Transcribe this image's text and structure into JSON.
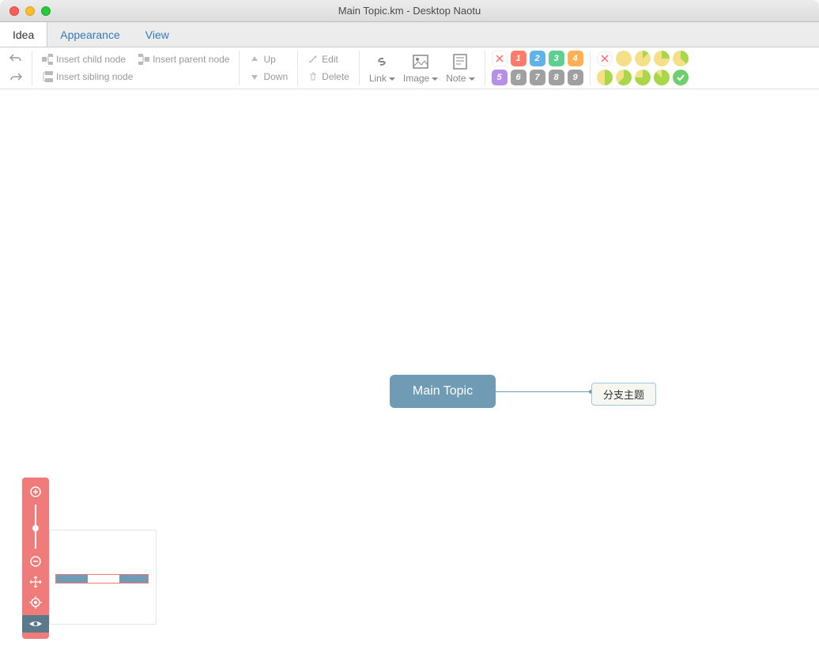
{
  "window": {
    "title": "Main Topic.km - Desktop Naotu"
  },
  "tabs": {
    "idea": "Idea",
    "appearance": "Appearance",
    "view": "View",
    "active": "idea"
  },
  "toolbar": {
    "undo": "Undo",
    "redo": "Redo",
    "insert_child": "Insert child node",
    "insert_parent": "Insert parent node",
    "insert_sibling": "Insert sibling node",
    "up": "Up",
    "down": "Down",
    "edit": "Edit",
    "delete": "Delete",
    "link": "Link",
    "image": "Image",
    "note": "Note"
  },
  "priority_badges": {
    "row1": [
      "1",
      "2",
      "3",
      "4"
    ],
    "row2": [
      "5",
      "6",
      "7",
      "8",
      "9"
    ],
    "row1_colors": [
      "#ff7b6b",
      "#5fb3e6",
      "#5fcf8f",
      "#ffb055"
    ],
    "row2_colors": [
      "#b98fe6",
      "#a0a0a0",
      "#a0a0a0",
      "#a0a0a0",
      "#a0a0a0"
    ]
  },
  "progress_colors": {
    "row1": [
      "#ff7b6b",
      "#f5e089",
      "#c3e04e",
      "#c3e04e",
      "#c3e04e"
    ],
    "row2": [
      "#f5e089",
      "#f5e089",
      "#c3e04e",
      "#a9d74a",
      "#6fcf6f"
    ]
  },
  "mindmap": {
    "root": "Main Topic",
    "child": "分支主题"
  },
  "nav": {
    "zoom_level": 1.0
  }
}
